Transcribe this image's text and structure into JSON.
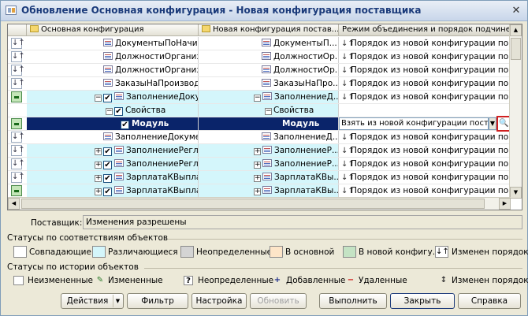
{
  "window": {
    "title": "Обновление Основная конфигурация - Новая конфигурация поставщика",
    "close_glyph": "✕"
  },
  "grid": {
    "headers": {
      "main": "Основная конфигурация",
      "supplier": "Новая конфигурация постав...",
      "mode": "Режим объединения и порядок подчине..."
    },
    "rows": [
      {
        "icon": "sort",
        "main": "ДокументыПоНачис...",
        "supplier": "ДокументыП...",
        "mode": "Порядок из новой конфигурации по...",
        "cyan": false
      },
      {
        "icon": "sort",
        "main": "ДолжностиОрганиза...",
        "supplier": "ДолжностиОр...",
        "mode": "Порядок из новой конфигурации по...",
        "cyan": false
      },
      {
        "icon": "sort",
        "main": "ДолжностиОрганиза...",
        "supplier": "ДолжностиОр...",
        "mode": "Порядок из новой конфигурации по...",
        "cyan": false
      },
      {
        "icon": "sort",
        "main": "ЗаказыНаПроизводс...",
        "supplier": "ЗаказыНаПро...",
        "mode": "Порядок из новой конфигурации по...",
        "cyan": false
      },
      {
        "icon": "merge",
        "main": "ЗаполнениеДокум...",
        "supplier": "ЗаполнениеД...",
        "mode": "Порядок из новой конфигурации по...",
        "cyan": true
      },
      {
        "icon": "none",
        "main": "Свойства",
        "supplier": "Свойства",
        "mode": "",
        "cyan": true
      },
      {
        "icon": "merge",
        "main": "Модуль",
        "supplier": "Модуль",
        "mode": "Взять из новой конфигурации поста",
        "cyan": false,
        "selected": true
      },
      {
        "icon": "sort",
        "main": "ЗаполнениеДокумен...",
        "supplier": "ЗаполнениеД...",
        "mode": "Порядок из новой конфигурации по...",
        "cyan": false
      },
      {
        "icon": "sort",
        "main": "ЗаполнениеРегла...",
        "supplier": "ЗаполнениеР...",
        "mode": "Порядок из новой конфигурации по...",
        "cyan": true
      },
      {
        "icon": "sort",
        "main": "ЗаполнениеРегла...",
        "supplier": "ЗаполнениеР...",
        "mode": "Порядок из новой конфигурации по...",
        "cyan": true
      },
      {
        "icon": "sort",
        "main": "ЗарплатаКВыплат...",
        "supplier": "ЗарплатаКВы...",
        "mode": "Порядок из новой конфигурации по...",
        "cyan": true
      },
      {
        "icon": "merge",
        "main": "ЗарплатаКВыплат...",
        "supplier": "ЗарплатаКВы...",
        "mode": "Порядок из новой конфигурации по...",
        "cyan": true
      }
    ],
    "combo_value": "Взять из новой конфигурации поста"
  },
  "supplier": {
    "label": "Поставщик:",
    "value": "Изменения разрешены"
  },
  "statuses_match": {
    "title": "Статусы по соответствиям объектов",
    "items": [
      {
        "label": "Совпадающие",
        "color": "#ffffff"
      },
      {
        "label": "Различающиеся",
        "color": "#d4f6fb"
      },
      {
        "label": "Неопределенные",
        "color": "#d4d4d4"
      },
      {
        "label": "В основной",
        "color": "#fde5c8"
      },
      {
        "label": "В новой конфигу...",
        "color": "#c4e3c4"
      },
      {
        "label": "Изменен порядок",
        "color": "#ffffff"
      }
    ]
  },
  "statuses_history": {
    "title": "Статусы по истории объектов",
    "items": [
      {
        "label": "Неизмененные",
        "glyph": ""
      },
      {
        "label": "Измененные",
        "glyph": "✎"
      },
      {
        "label": "Неопределенные",
        "glyph": "?"
      },
      {
        "label": "Добавленные",
        "glyph": "+"
      },
      {
        "label": "Удаленные",
        "glyph": "−"
      },
      {
        "label": "Изменен порядок",
        "glyph": "↕"
      }
    ]
  },
  "buttons": {
    "actions": "Действия",
    "filter": "Фильтр",
    "settings": "Настройка",
    "refresh": "Обновить",
    "execute": "Выполнить",
    "close": "Закрыть",
    "help": "Справка"
  }
}
